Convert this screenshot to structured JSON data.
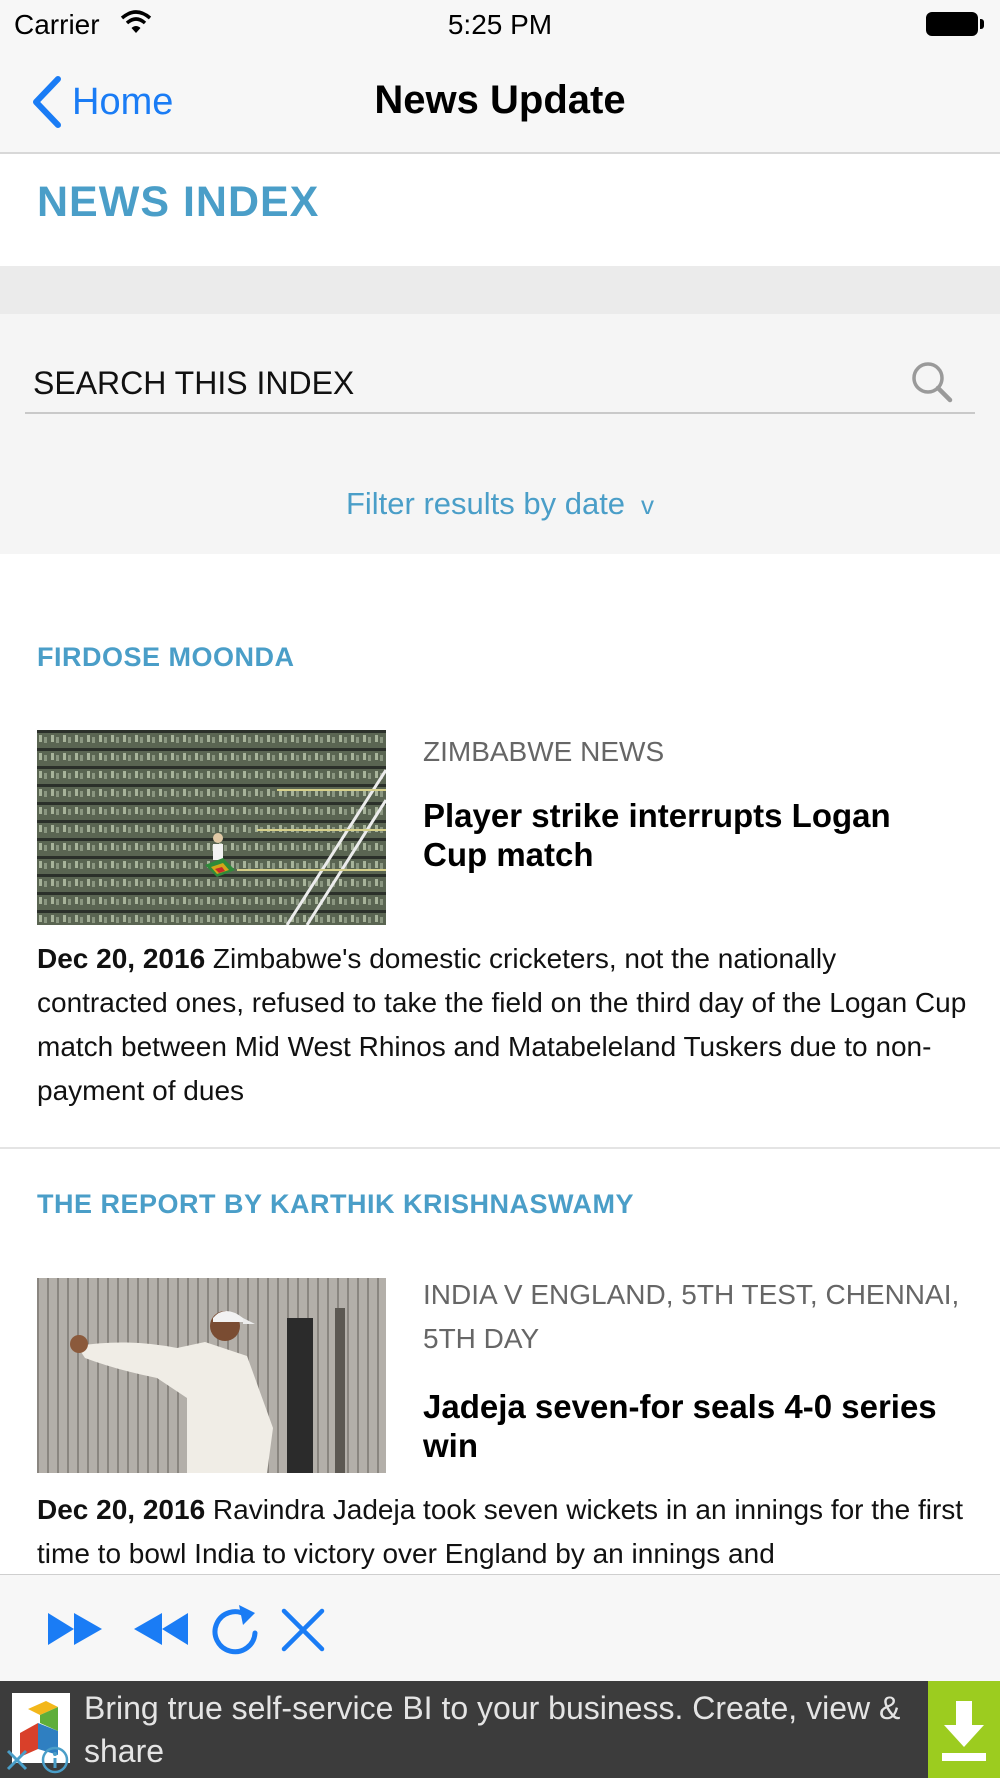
{
  "status_bar": {
    "carrier": "Carrier",
    "time": "5:25 PM"
  },
  "nav": {
    "back_label": "Home",
    "title": "News Update"
  },
  "index": {
    "title": "NEWS INDEX"
  },
  "search": {
    "placeholder": "SEARCH THIS INDEX",
    "filter_label": "Filter results by date",
    "filter_chevron": "v"
  },
  "articles": [
    {
      "byline": "FIRDOSE MOONDA",
      "category": "ZIMBABWE NEWS",
      "headline": "Player strike interrupts Logan Cup match",
      "date": "Dec 20, 2016",
      "summary": "Zimbabwe's domestic cricketers, not the nationally contracted ones, refused to take the field on the third day of the Logan Cup match between Mid West Rhinos and Matabeleland Tuskers due to non-payment of dues"
    },
    {
      "byline": "THE REPORT BY KARTHIK KRISHNASWAMY",
      "category": "INDIA V ENGLAND, 5TH TEST, CHENNAI, 5TH DAY",
      "headline": "Jadeja seven-for seals 4-0 series win",
      "date": "Dec 20, 2016",
      "summary": "Ravindra Jadeja took seven wickets in an innings for the first time to bowl India to victory over England by an innings and"
    }
  ],
  "toolbar": {
    "icons": [
      "fast-forward-icon",
      "rewind-icon",
      "refresh-icon",
      "close-icon"
    ]
  },
  "ad": {
    "text": "Bring true self-service BI to your business. Create, view & share"
  },
  "colors": {
    "accent": "#4a9ec8",
    "ios_blue": "#1a7cf5",
    "ad_green": "#9ccc1f"
  }
}
